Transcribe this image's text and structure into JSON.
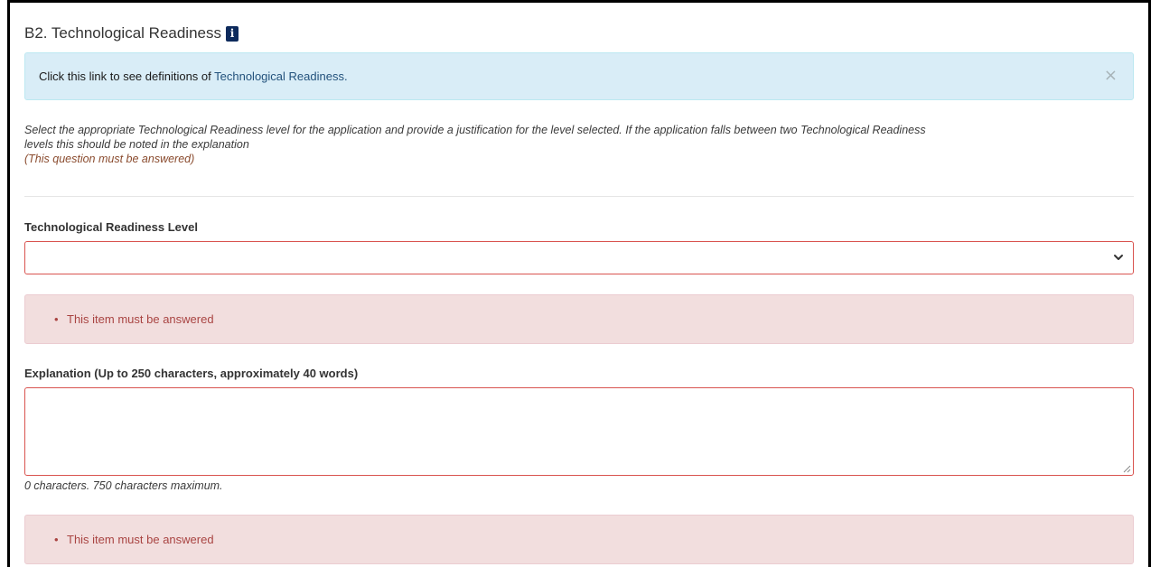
{
  "section": {
    "title": "B2. Technological Readiness",
    "info_icon": "info-icon"
  },
  "info_alert": {
    "text": "Click this link to see definitions of ",
    "link_text": "Technological Readiness.",
    "close_symbol": "×"
  },
  "instructions": {
    "line1": "Select the appropriate Technological Readiness level for the application and provide a justification for the level selected. If the application falls between two Technological Readiness",
    "line2": "levels this should be noted in the explanation",
    "required": "(This question must be answered)"
  },
  "readiness_level": {
    "label": "Technological Readiness Level",
    "selected_value": "",
    "error_bullet": "•",
    "error": "This item must be answered"
  },
  "explanation": {
    "label": "Explanation (Up to 250 characters, approximately 40 words)",
    "value": "",
    "char_count": "0 characters. 750 characters maximum.",
    "error_bullet": "•",
    "error": "This item must be answered"
  },
  "colors": {
    "info_bg": "#d9edf7",
    "error_bg": "#f2dede",
    "error_text": "#a94442",
    "error_border": "#d9534f",
    "link": "#23527c"
  }
}
